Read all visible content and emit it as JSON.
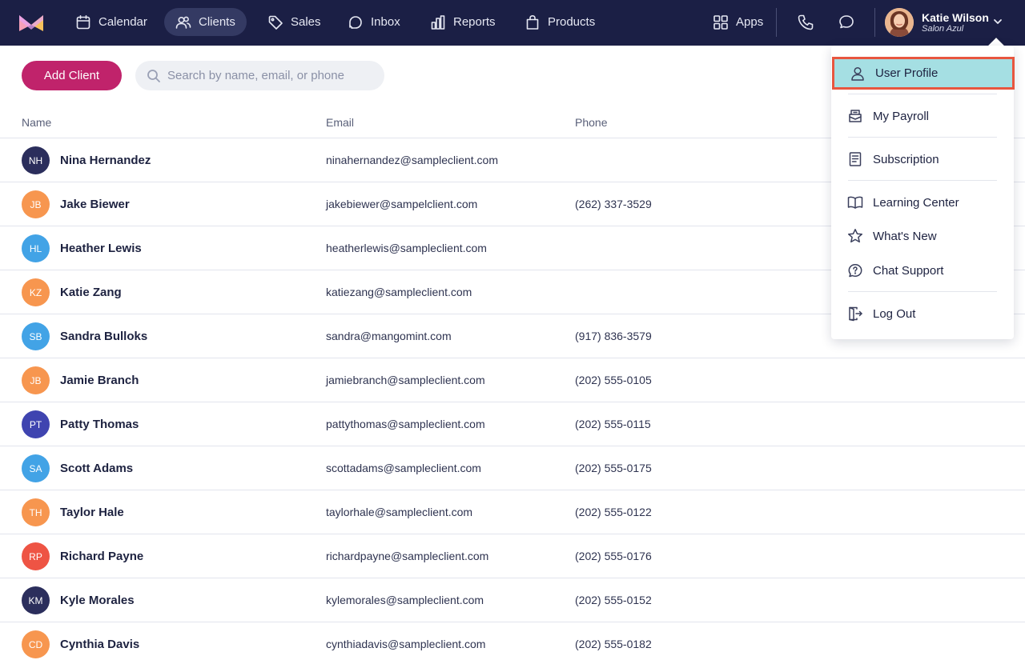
{
  "nav": {
    "items": [
      {
        "label": "Calendar",
        "icon": "calendar-icon"
      },
      {
        "label": "Clients",
        "icon": "users-icon"
      },
      {
        "label": "Sales",
        "icon": "tag-icon"
      },
      {
        "label": "Inbox",
        "icon": "inbox-icon"
      },
      {
        "label": "Reports",
        "icon": "bar-chart-icon"
      },
      {
        "label": "Products",
        "icon": "shopping-bag-icon"
      }
    ],
    "apps_label": "Apps",
    "active": "Clients"
  },
  "user": {
    "name": "Katie Wilson",
    "org": "Salon Azul"
  },
  "toolbar": {
    "add_label": "Add Client",
    "search_placeholder": "Search by name, email, or phone"
  },
  "table": {
    "headers": {
      "name": "Name",
      "email": "Email",
      "phone": "Phone"
    },
    "rows": [
      {
        "initials": "NH",
        "color": "#2b2e5c",
        "name": "Nina Hernandez",
        "email": "ninahernandez@sampleclient.com",
        "phone": ""
      },
      {
        "initials": "JB",
        "color": "#f7964f",
        "name": "Jake Biewer",
        "email": "jakebiewer@sampelclient.com",
        "phone": "(262) 337-3529"
      },
      {
        "initials": "HL",
        "color": "#42a3e6",
        "name": "Heather Lewis",
        "email": "heatherlewis@sampleclient.com",
        "phone": ""
      },
      {
        "initials": "KZ",
        "color": "#f7964f",
        "name": "Katie Zang",
        "email": "katiezang@sampleclient.com",
        "phone": ""
      },
      {
        "initials": "SB",
        "color": "#42a3e6",
        "name": "Sandra Bulloks",
        "email": "sandra@mangomint.com",
        "phone": "(917) 836-3579"
      },
      {
        "initials": "JB",
        "color": "#f7964f",
        "name": "Jamie Branch",
        "email": "jamiebranch@sampleclient.com",
        "phone": "(202) 555-0105"
      },
      {
        "initials": "PT",
        "color": "#3f44b0",
        "name": "Patty Thomas",
        "email": "pattythomas@sampleclient.com",
        "phone": "(202) 555-0115"
      },
      {
        "initials": "SA",
        "color": "#42a3e6",
        "name": "Scott Adams",
        "email": "scottadams@sampleclient.com",
        "phone": "(202) 555-0175"
      },
      {
        "initials": "TH",
        "color": "#f7964f",
        "name": "Taylor Hale",
        "email": "taylorhale@sampleclient.com",
        "phone": "(202) 555-0122"
      },
      {
        "initials": "RP",
        "color": "#ee5444",
        "name": "Richard Payne",
        "email": "richardpayne@sampleclient.com",
        "phone": "(202) 555-0176"
      },
      {
        "initials": "KM",
        "color": "#2b2e5c",
        "name": "Kyle Morales",
        "email": "kylemorales@sampleclient.com",
        "phone": "(202) 555-0152"
      },
      {
        "initials": "CD",
        "color": "#f7964f",
        "name": "Cynthia Davis",
        "email": "cynthiadavis@sampleclient.com",
        "phone": "(202) 555-0182"
      }
    ]
  },
  "menu": {
    "items": [
      {
        "label": "User Profile",
        "icon": "user-icon"
      },
      {
        "label": "My Payroll",
        "icon": "payroll-icon"
      },
      {
        "label": "Subscription",
        "icon": "receipt-icon"
      },
      {
        "label": "Learning Center",
        "icon": "book-icon"
      },
      {
        "label": "What's New",
        "icon": "star-icon"
      },
      {
        "label": "Chat Support",
        "icon": "chat-help-icon"
      },
      {
        "label": "Log Out",
        "icon": "logout-icon"
      }
    ]
  },
  "colors": {
    "nav_bg": "#1b1f45",
    "accent": "#c0236b",
    "highlight": "#a5dfe3",
    "highlight_border": "#e8563f"
  }
}
